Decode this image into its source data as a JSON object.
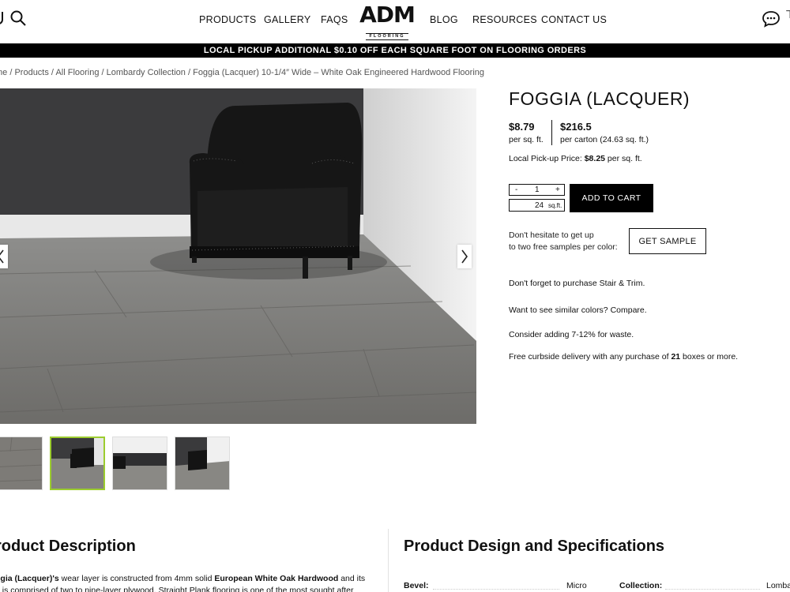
{
  "header": {
    "nav_left": [
      "PRODUCTS",
      "GALLERY",
      "FAQS"
    ],
    "nav_right": [
      "BLOG",
      "RESOURCES",
      "CONTACT US"
    ],
    "logo": "ADM",
    "logo_sub": "FLOORING"
  },
  "promo": "LOCAL PICKUP ADDITIONAL $0.10 OFF EACH SQUARE FOOT ON FLOORING ORDERS",
  "breadcrumb": {
    "items": [
      "me",
      "Products",
      "All Flooring",
      "Lombardy Collection",
      "Foggia (Lacquer) 10-1/4″ Wide – White Oak Engineered Hardwood Flooring"
    ],
    "separator": " / "
  },
  "product": {
    "title": "FOGGIA (LACQUER)",
    "price_sqft": "$8.79",
    "price_sqft_unit": "per sq. ft.",
    "price_carton": "$216.5",
    "price_carton_unit": "per carton (24.63 sq. ft.)",
    "pickup_label": "Local Pick-up Price:",
    "pickup_value": "$8.25",
    "pickup_unit": "per sq. ft.",
    "qty_minus": "-",
    "qty_value": "1",
    "qty_plus": "+",
    "sqft_value": "24",
    "sqft_unit": "sq.ft.",
    "add_to_cart": "ADD TO CART",
    "sample_line1": "Don't hesitate to get up",
    "sample_line2": "to two free samples per color:",
    "sample_button": "GET SAMPLE",
    "note_trim_prefix": "Don't forget to purchase",
    "note_trim_link": "Stair & Trim.",
    "note_similar_prefix": "Want to see similar colors?",
    "note_similar_link": "Compare.",
    "note_waste": "Consider adding 7-12% for waste.",
    "note_delivery_prefix": "Free curbside delivery with any purchase of",
    "note_delivery_count": "21",
    "note_delivery_suffix": "boxes or more."
  },
  "description": {
    "title": "roduct Description",
    "line1_a": "ggia (Lacquer)'s",
    "line1_b": " wear layer is constructed from 4mm solid ",
    "line1_c": "European White Oak Hardwood",
    "line1_d": " and its",
    "line2": "e is comprised of two to nine-layer plywood. Straight Plank flooring is one of the most sought after"
  },
  "specs": {
    "title": "Product Design and Specifications",
    "bevel_label": "Bevel:",
    "bevel_value": "Micro",
    "collection_label": "Collection:",
    "collection_value": "Lomba"
  },
  "icons": {
    "search": "search-icon",
    "chat": "chat-icon",
    "prev": "chevron-left-icon",
    "next": "chevron-right-icon"
  },
  "colors": {
    "accent_thumb": "#9ccc2f",
    "promo_bg": "#000000"
  }
}
